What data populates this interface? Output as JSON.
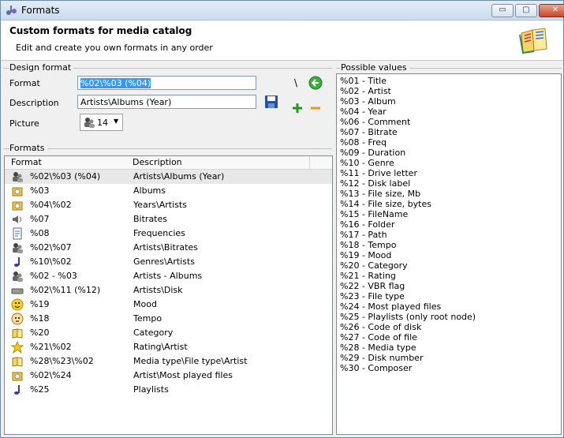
{
  "window": {
    "title": "Formats",
    "buttons": {
      "minimize": "▭",
      "maximize": "▢",
      "close": "✕"
    }
  },
  "header": {
    "title": "Custom formats for media catalog",
    "subtitle": "Edit and create you own formats in any order"
  },
  "design": {
    "group_label": "Design format",
    "format_label": "Format",
    "format_value": "%02\\%03 (%04)",
    "description_label": "Description",
    "description_value": "Artists\\Albums (Year)",
    "picture_label": "Picture",
    "picture_value": "14",
    "separator_symbol": "\\"
  },
  "formats": {
    "group_label": "Formats",
    "columns": {
      "format": "Format",
      "description": "Description"
    },
    "rows": [
      {
        "format": "%02\\%03 (%04)",
        "description": "Artists\\Albums (Year)",
        "icon": "artist-icon"
      },
      {
        "format": "%03",
        "description": "Albums",
        "icon": "album-icon"
      },
      {
        "format": "%04\\%02",
        "description": "Years\\Artists",
        "icon": "album-icon"
      },
      {
        "format": "%07",
        "description": "Bitrates",
        "icon": "speaker-icon"
      },
      {
        "format": "%08",
        "description": "Frequencies",
        "icon": "document-icon"
      },
      {
        "format": "%02\\%07",
        "description": "Artists\\Bitrates",
        "icon": "artist-icon"
      },
      {
        "format": "%10\\%02",
        "description": "Genres\\Artists",
        "icon": "note-icon"
      },
      {
        "format": "%02 - %03",
        "description": "Artists - Albums",
        "icon": "artist-icon"
      },
      {
        "format": "%02\\%11 (%12)",
        "description": "Artists\\Disk",
        "icon": "drive-icon"
      },
      {
        "format": "%19",
        "description": "Mood",
        "icon": "smiley-icon"
      },
      {
        "format": "%18",
        "description": "Tempo",
        "icon": "face-icon"
      },
      {
        "format": "%20",
        "description": "Category",
        "icon": "book-icon"
      },
      {
        "format": "%21\\%02",
        "description": "Rating\\Artist",
        "icon": "star-icon"
      },
      {
        "format": "%28\\%23\\%02",
        "description": "Media type\\File type\\Artist",
        "icon": "book-icon"
      },
      {
        "format": "%02\\%24",
        "description": "Artist\\Most played files",
        "icon": "album-icon"
      },
      {
        "format": "%25",
        "description": "Playlists",
        "icon": "note-icon"
      }
    ]
  },
  "possible": {
    "group_label": "Possible values",
    "items": [
      "%01 - Title",
      "%02 - Artist",
      "%03 - Album",
      "%04 - Year",
      "%06 - Comment",
      "%07 - Bitrate",
      "%08 - Freq",
      "%09 - Duration",
      "%10 - Genre",
      "%11 - Drive letter",
      "%12 - Disk label",
      "%13 - File size, Mb",
      "%14 - File size, bytes",
      "%15 - FileName",
      "%16 - Folder",
      "%17 - Path",
      "%18 - Tempo",
      "%19 - Mood",
      "%20 - Category",
      "%21 - Rating",
      "%22 - VBR flag",
      "%23 - File type",
      "%24 - Most played files",
      "%25 - Playlists (only root node)",
      "%26 - Code of disk",
      "%27 - Code of file",
      "%28 - Media type",
      "%29 - Disk number",
      "%30 - Composer"
    ]
  },
  "colors": {
    "selection": "#3399ff",
    "accent_green": "#2e9e2e",
    "title_gradient_top": "#e3edf7"
  }
}
